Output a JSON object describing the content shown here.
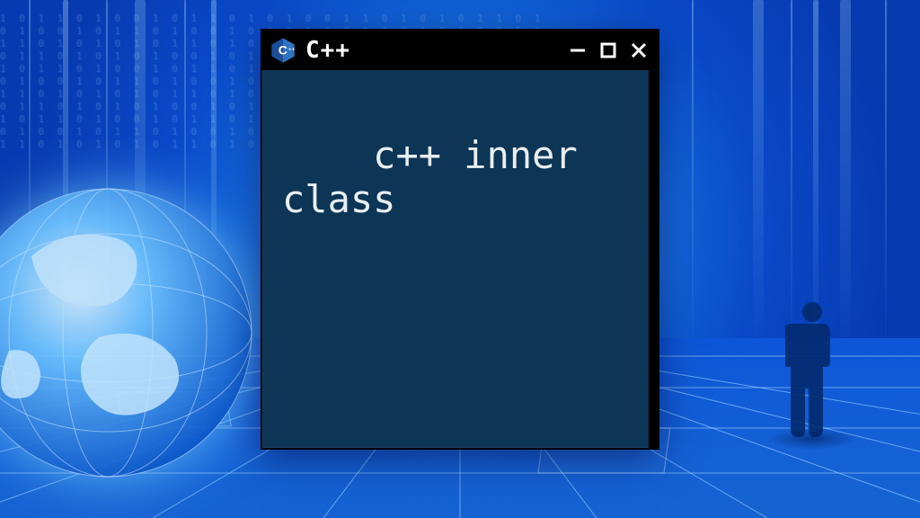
{
  "window": {
    "title": "C++",
    "icon_name": "cpp-logo-icon",
    "controls": {
      "minimize_name": "minimize-icon",
      "maximize_name": "maximize-icon",
      "close_name": "close-icon"
    }
  },
  "terminal": {
    "content": "c++ inner class"
  },
  "background": {
    "globe_name": "globe-decoration",
    "person_name": "standing-person-silhouette"
  },
  "colors": {
    "terminal_bg": "#0c3556",
    "terminal_fg": "#e9eef0",
    "titlebar_bg": "#000000",
    "glow": "#7fd0ff"
  }
}
